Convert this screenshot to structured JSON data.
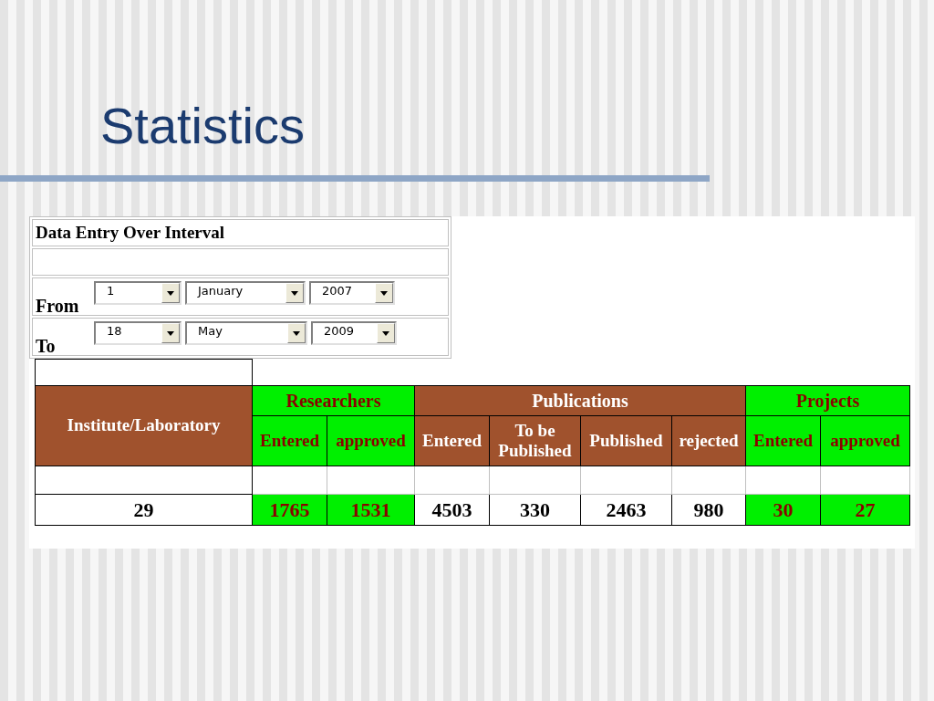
{
  "slide": {
    "title": "Statistics"
  },
  "form": {
    "title": "Data Entry Over Interval",
    "rows": [
      {
        "label": "From",
        "selects": [
          {
            "value": "1"
          },
          {
            "value": "January"
          },
          {
            "value": "2007"
          }
        ]
      },
      {
        "label": "To",
        "selects": [
          {
            "value": "18"
          },
          {
            "value": "May"
          },
          {
            "value": "2009"
          }
        ]
      }
    ]
  },
  "table": {
    "first_column": "Institute/Laboratory",
    "groups": [
      {
        "label": "Researchers",
        "color": "#00f000",
        "highlighted": true,
        "columns": [
          "Entered",
          "approved"
        ]
      },
      {
        "label": "Publications",
        "color": "#a0522d",
        "highlighted": false,
        "columns": [
          "Entered",
          "To be Published",
          "Published",
          "rejected"
        ]
      },
      {
        "label": "Projects",
        "color": "#00f000",
        "highlighted": true,
        "columns": [
          "Entered",
          "approved"
        ]
      }
    ],
    "rows": [
      {
        "institute": "29",
        "values": [
          "1765",
          "1531",
          "4503",
          "330",
          "2463",
          "980",
          "30",
          "27"
        ]
      }
    ]
  }
}
